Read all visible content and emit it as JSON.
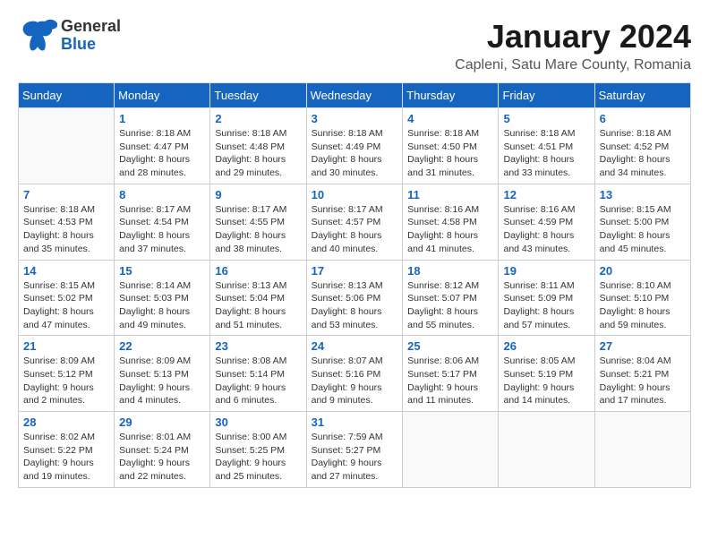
{
  "header": {
    "logo_general": "General",
    "logo_blue": "Blue",
    "month_title": "January 2024",
    "location": "Capleni, Satu Mare County, Romania"
  },
  "days_of_week": [
    "Sunday",
    "Monday",
    "Tuesday",
    "Wednesday",
    "Thursday",
    "Friday",
    "Saturday"
  ],
  "weeks": [
    [
      {
        "day": "",
        "sunrise": "",
        "sunset": "",
        "daylight": ""
      },
      {
        "day": "1",
        "sunrise": "Sunrise: 8:18 AM",
        "sunset": "Sunset: 4:47 PM",
        "daylight": "Daylight: 8 hours and 28 minutes."
      },
      {
        "day": "2",
        "sunrise": "Sunrise: 8:18 AM",
        "sunset": "Sunset: 4:48 PM",
        "daylight": "Daylight: 8 hours and 29 minutes."
      },
      {
        "day": "3",
        "sunrise": "Sunrise: 8:18 AM",
        "sunset": "Sunset: 4:49 PM",
        "daylight": "Daylight: 8 hours and 30 minutes."
      },
      {
        "day": "4",
        "sunrise": "Sunrise: 8:18 AM",
        "sunset": "Sunset: 4:50 PM",
        "daylight": "Daylight: 8 hours and 31 minutes."
      },
      {
        "day": "5",
        "sunrise": "Sunrise: 8:18 AM",
        "sunset": "Sunset: 4:51 PM",
        "daylight": "Daylight: 8 hours and 33 minutes."
      },
      {
        "day": "6",
        "sunrise": "Sunrise: 8:18 AM",
        "sunset": "Sunset: 4:52 PM",
        "daylight": "Daylight: 8 hours and 34 minutes."
      }
    ],
    [
      {
        "day": "7",
        "sunrise": "Sunrise: 8:18 AM",
        "sunset": "Sunset: 4:53 PM",
        "daylight": "Daylight: 8 hours and 35 minutes."
      },
      {
        "day": "8",
        "sunrise": "Sunrise: 8:17 AM",
        "sunset": "Sunset: 4:54 PM",
        "daylight": "Daylight: 8 hours and 37 minutes."
      },
      {
        "day": "9",
        "sunrise": "Sunrise: 8:17 AM",
        "sunset": "Sunset: 4:55 PM",
        "daylight": "Daylight: 8 hours and 38 minutes."
      },
      {
        "day": "10",
        "sunrise": "Sunrise: 8:17 AM",
        "sunset": "Sunset: 4:57 PM",
        "daylight": "Daylight: 8 hours and 40 minutes."
      },
      {
        "day": "11",
        "sunrise": "Sunrise: 8:16 AM",
        "sunset": "Sunset: 4:58 PM",
        "daylight": "Daylight: 8 hours and 41 minutes."
      },
      {
        "day": "12",
        "sunrise": "Sunrise: 8:16 AM",
        "sunset": "Sunset: 4:59 PM",
        "daylight": "Daylight: 8 hours and 43 minutes."
      },
      {
        "day": "13",
        "sunrise": "Sunrise: 8:15 AM",
        "sunset": "Sunset: 5:00 PM",
        "daylight": "Daylight: 8 hours and 45 minutes."
      }
    ],
    [
      {
        "day": "14",
        "sunrise": "Sunrise: 8:15 AM",
        "sunset": "Sunset: 5:02 PM",
        "daylight": "Daylight: 8 hours and 47 minutes."
      },
      {
        "day": "15",
        "sunrise": "Sunrise: 8:14 AM",
        "sunset": "Sunset: 5:03 PM",
        "daylight": "Daylight: 8 hours and 49 minutes."
      },
      {
        "day": "16",
        "sunrise": "Sunrise: 8:13 AM",
        "sunset": "Sunset: 5:04 PM",
        "daylight": "Daylight: 8 hours and 51 minutes."
      },
      {
        "day": "17",
        "sunrise": "Sunrise: 8:13 AM",
        "sunset": "Sunset: 5:06 PM",
        "daylight": "Daylight: 8 hours and 53 minutes."
      },
      {
        "day": "18",
        "sunrise": "Sunrise: 8:12 AM",
        "sunset": "Sunset: 5:07 PM",
        "daylight": "Daylight: 8 hours and 55 minutes."
      },
      {
        "day": "19",
        "sunrise": "Sunrise: 8:11 AM",
        "sunset": "Sunset: 5:09 PM",
        "daylight": "Daylight: 8 hours and 57 minutes."
      },
      {
        "day": "20",
        "sunrise": "Sunrise: 8:10 AM",
        "sunset": "Sunset: 5:10 PM",
        "daylight": "Daylight: 8 hours and 59 minutes."
      }
    ],
    [
      {
        "day": "21",
        "sunrise": "Sunrise: 8:09 AM",
        "sunset": "Sunset: 5:12 PM",
        "daylight": "Daylight: 9 hours and 2 minutes."
      },
      {
        "day": "22",
        "sunrise": "Sunrise: 8:09 AM",
        "sunset": "Sunset: 5:13 PM",
        "daylight": "Daylight: 9 hours and 4 minutes."
      },
      {
        "day": "23",
        "sunrise": "Sunrise: 8:08 AM",
        "sunset": "Sunset: 5:14 PM",
        "daylight": "Daylight: 9 hours and 6 minutes."
      },
      {
        "day": "24",
        "sunrise": "Sunrise: 8:07 AM",
        "sunset": "Sunset: 5:16 PM",
        "daylight": "Daylight: 9 hours and 9 minutes."
      },
      {
        "day": "25",
        "sunrise": "Sunrise: 8:06 AM",
        "sunset": "Sunset: 5:17 PM",
        "daylight": "Daylight: 9 hours and 11 minutes."
      },
      {
        "day": "26",
        "sunrise": "Sunrise: 8:05 AM",
        "sunset": "Sunset: 5:19 PM",
        "daylight": "Daylight: 9 hours and 14 minutes."
      },
      {
        "day": "27",
        "sunrise": "Sunrise: 8:04 AM",
        "sunset": "Sunset: 5:21 PM",
        "daylight": "Daylight: 9 hours and 17 minutes."
      }
    ],
    [
      {
        "day": "28",
        "sunrise": "Sunrise: 8:02 AM",
        "sunset": "Sunset: 5:22 PM",
        "daylight": "Daylight: 9 hours and 19 minutes."
      },
      {
        "day": "29",
        "sunrise": "Sunrise: 8:01 AM",
        "sunset": "Sunset: 5:24 PM",
        "daylight": "Daylight: 9 hours and 22 minutes."
      },
      {
        "day": "30",
        "sunrise": "Sunrise: 8:00 AM",
        "sunset": "Sunset: 5:25 PM",
        "daylight": "Daylight: 9 hours and 25 minutes."
      },
      {
        "day": "31",
        "sunrise": "Sunrise: 7:59 AM",
        "sunset": "Sunset: 5:27 PM",
        "daylight": "Daylight: 9 hours and 27 minutes."
      },
      {
        "day": "",
        "sunrise": "",
        "sunset": "",
        "daylight": ""
      },
      {
        "day": "",
        "sunrise": "",
        "sunset": "",
        "daylight": ""
      },
      {
        "day": "",
        "sunrise": "",
        "sunset": "",
        "daylight": ""
      }
    ]
  ]
}
